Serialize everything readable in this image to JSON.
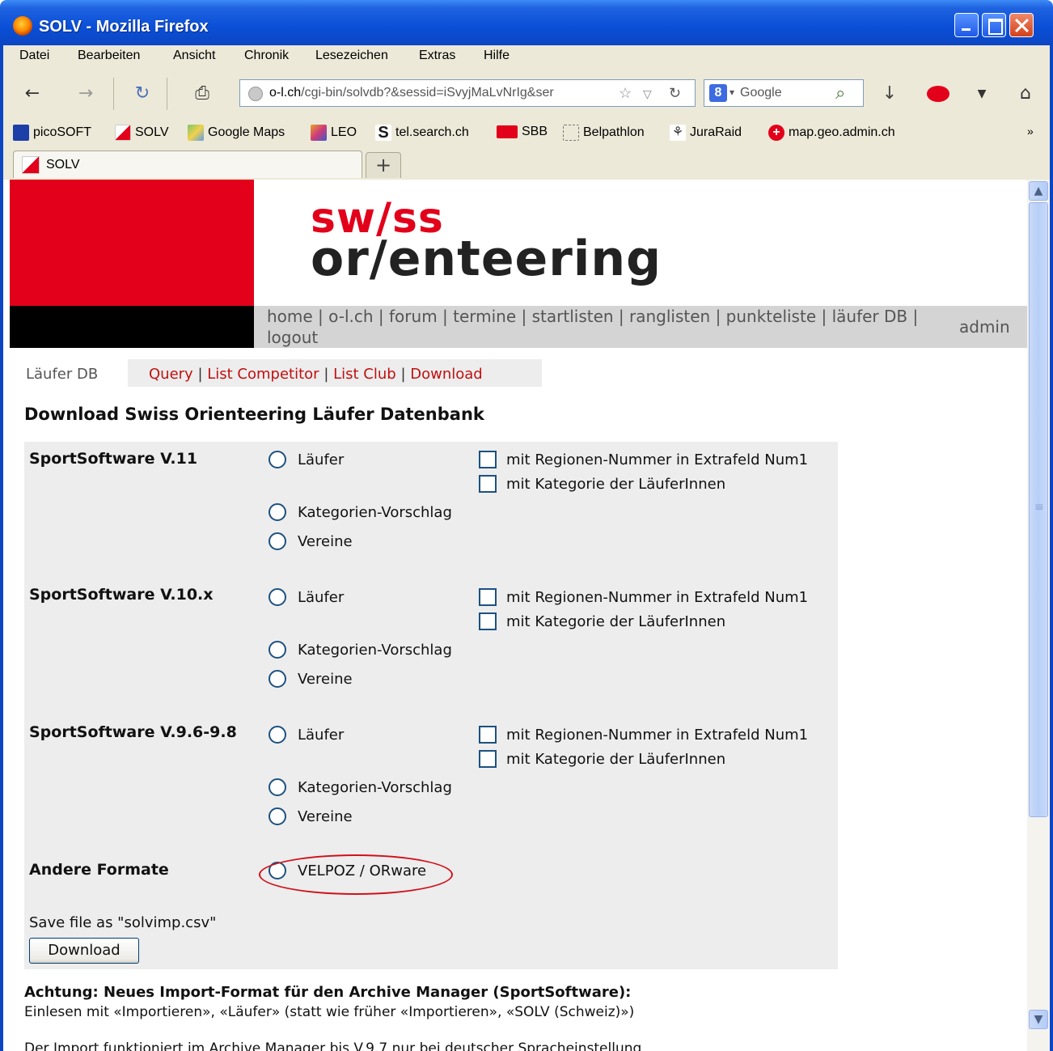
{
  "window": {
    "title": "SOLV - Mozilla Firefox"
  },
  "menubar": [
    "Datei",
    "Bearbeiten",
    "Ansicht",
    "Chronik",
    "Lesezeichen",
    "Extras",
    "Hilfe"
  ],
  "navbar": {
    "url_domain": "o-l.ch",
    "url_rest": "/cgi-bin/solvdb?&sessid=iSvyjMaLvNrIg&ser",
    "search_engine": "Google"
  },
  "bookmarks": [
    "picoSOFT",
    "SOLV",
    "Google Maps",
    "LEO",
    "tel.search.ch",
    "SBB",
    "Belpathlon",
    "JuraRaid",
    "map.geo.admin.ch"
  ],
  "bookmarks_overflow": "»",
  "tab": {
    "label": "SOLV",
    "new_tab": "+"
  },
  "site": {
    "logo_line1": "sw/ss",
    "logo_line2": "or/enteering",
    "nav_links": "home | o-l.ch | forum | termine | startlisten | ranglisten | punkteliste | läufer DB | logout",
    "admin": "admin"
  },
  "subnav": {
    "current": "Läufer DB",
    "links": [
      "Query",
      "List Competitor",
      "List Club",
      "Download"
    ]
  },
  "page_title": "Download Swiss Orienteering Läufer Datenbank",
  "sections": [
    {
      "label": "SportSoftware V.11",
      "radios": [
        "Läufer",
        "Kategorien-Vorschlag",
        "Vereine"
      ],
      "checks": [
        "mit Regionen-Nummer in Extrafeld Num1",
        "mit Kategorie der LäuferInnen"
      ]
    },
    {
      "label": "SportSoftware V.10.x",
      "radios": [
        "Läufer",
        "Kategorien-Vorschlag",
        "Vereine"
      ],
      "checks": [
        "mit Regionen-Nummer in Extrafeld Num1",
        "mit Kategorie der LäuferInnen"
      ]
    },
    {
      "label": "SportSoftware V.9.6-9.8",
      "radios": [
        "Läufer",
        "Kategorien-Vorschlag",
        "Vereine"
      ],
      "checks": [
        "mit Regionen-Nummer in Extrafeld Num1",
        "mit Kategorie der LäuferInnen"
      ]
    },
    {
      "label": "Andere Formate",
      "radios": [
        "VELPOZ / ORware"
      ],
      "checks": []
    }
  ],
  "save_as": "Save file as \"solvimp.csv\"",
  "download_button": "Download",
  "notes": {
    "bold": "Achtung: Neues Import-Format für den Archive Manager (SportSoftware):",
    "line1": "Einlesen mit «Importieren», «Läufer» (statt wie früher «Importieren», «SOLV (Schweiz)»)",
    "line2": "Der Import funktioniert im Archive Manager bis V.9.7 nur bei deutscher Spracheinstellung"
  },
  "colors": {
    "accent_red": "#e2001a",
    "link_red": "#c01010",
    "titlebar_blue": "#0a4fd6",
    "highlight_circle": "#d0101a"
  }
}
